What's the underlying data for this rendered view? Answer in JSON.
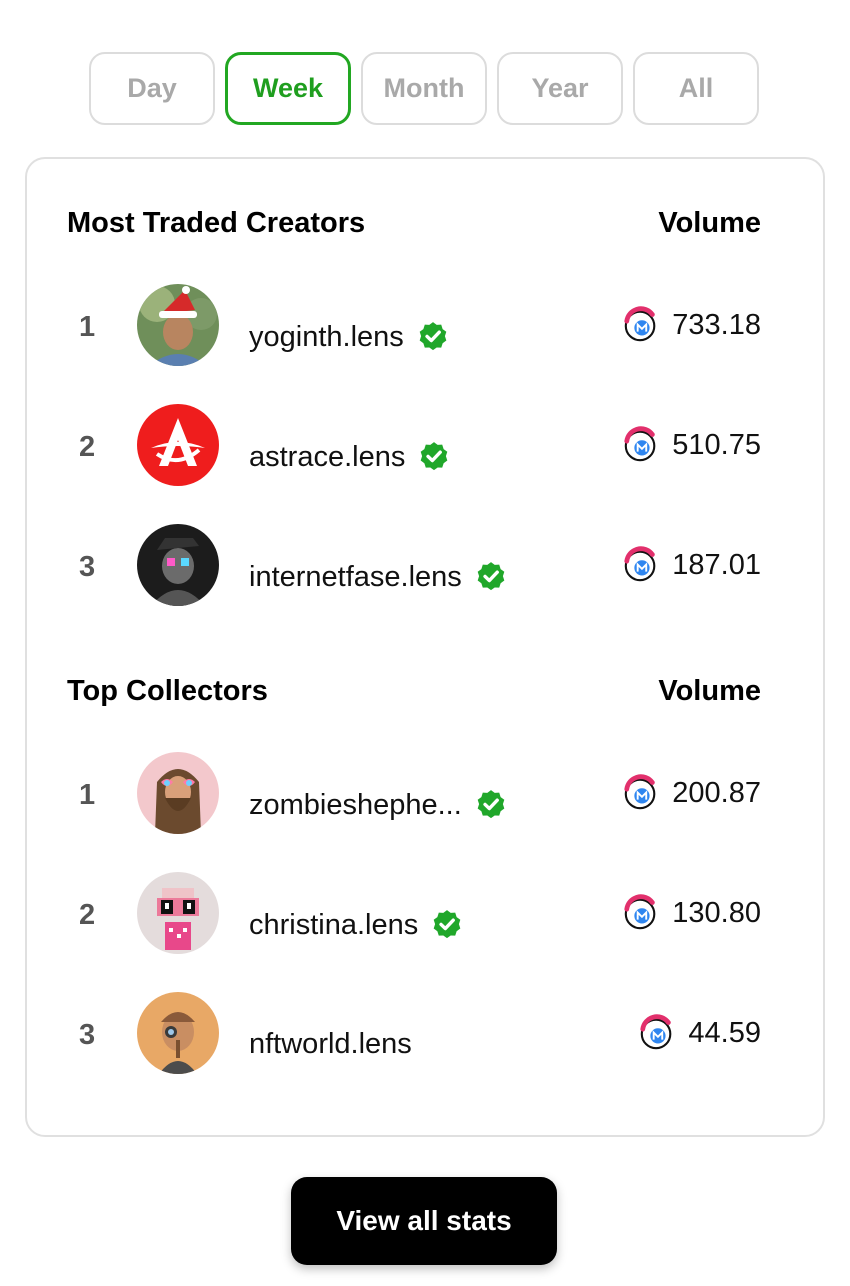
{
  "tabs": [
    {
      "label": "Day",
      "active": false
    },
    {
      "label": "Week",
      "active": true
    },
    {
      "label": "Month",
      "active": false
    },
    {
      "label": "Year",
      "active": false
    },
    {
      "label": "All",
      "active": false
    }
  ],
  "creators": {
    "title": "Most Traded Creators",
    "volume_label": "Volume",
    "rows": [
      {
        "rank": "1",
        "name": "yoginth.lens",
        "verified": true,
        "volume": "733.18"
      },
      {
        "rank": "2",
        "name": "astrace.lens",
        "verified": true,
        "volume": "510.75"
      },
      {
        "rank": "3",
        "name": "internetfase.lens",
        "verified": true,
        "volume": "187.01"
      }
    ]
  },
  "collectors": {
    "title": "Top Collectors",
    "volume_label": "Volume",
    "rows": [
      {
        "rank": "1",
        "name": "zombieshephe...",
        "verified": true,
        "volume": "200.87"
      },
      {
        "rank": "2",
        "name": "christina.lens",
        "verified": true,
        "volume": "130.80"
      },
      {
        "rank": "3",
        "name": "nftworld.lens",
        "verified": false,
        "volume": "44.59"
      }
    ]
  },
  "view_all_label": "View all stats",
  "colors": {
    "accent": "#22a722",
    "verified": "#20a72a",
    "button_bg": "#000000"
  },
  "icons": {
    "verified": "verified-badge-icon",
    "token": "token-coin-icon"
  }
}
